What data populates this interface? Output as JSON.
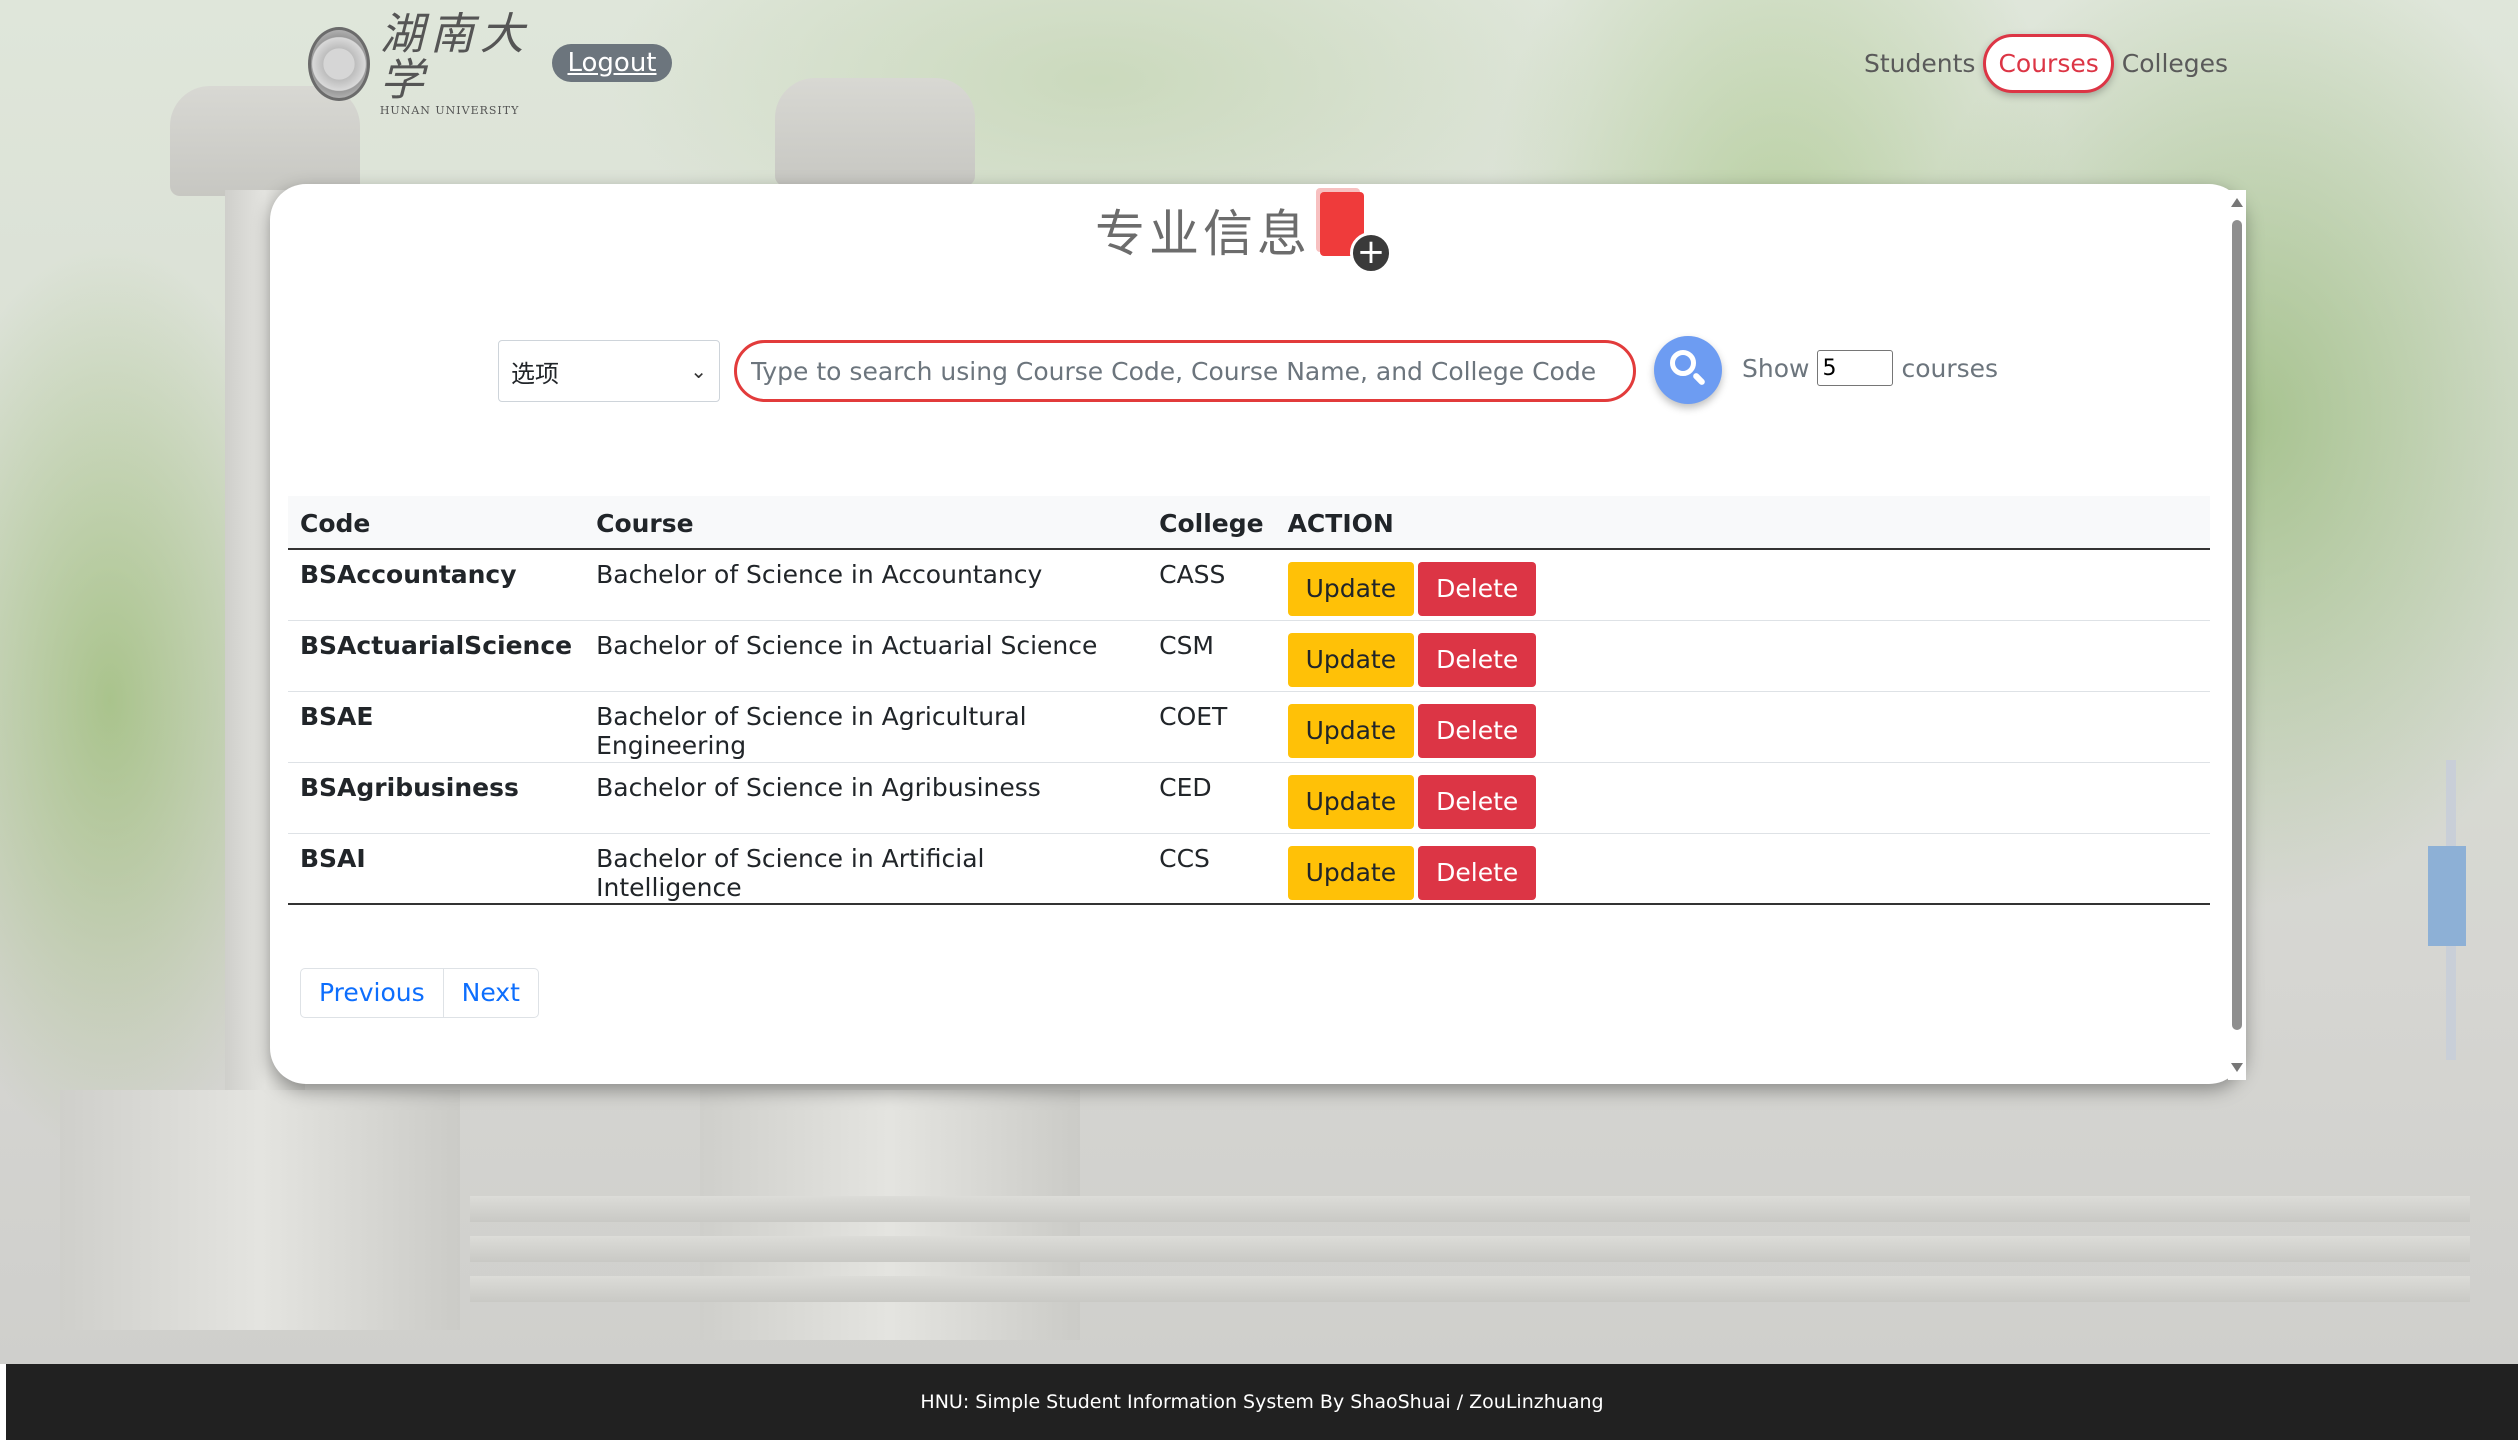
{
  "header": {
    "logo_cn": "湖南大学",
    "logo_en": "HUNAN UNIVERSITY",
    "logout_label": "Logout",
    "nav": [
      {
        "label": "Students",
        "active": false
      },
      {
        "label": "Courses",
        "active": true
      },
      {
        "label": "Colleges",
        "active": false
      }
    ]
  },
  "card": {
    "title": "专业信息",
    "add_icon": "add-document-icon"
  },
  "search": {
    "select_value": "选项",
    "placeholder": "Type to search using Course Code, Course Name, and College Code",
    "show_label": "Show",
    "show_value": "5",
    "show_suffix": "courses"
  },
  "table": {
    "headers": [
      "Code",
      "Course",
      "College",
      "ACTION"
    ],
    "rows": [
      {
        "code": "BSAccountancy",
        "course": "Bachelor of Science in Accountancy",
        "college": "CASS"
      },
      {
        "code": "BSActuarialScience",
        "course": "Bachelor of Science in Actuarial Science",
        "college": "CSM"
      },
      {
        "code": "BSAE",
        "course": "Bachelor of Science in Agricultural Engineering",
        "college": "COET"
      },
      {
        "code": "BSAgribusiness",
        "course": "Bachelor of Science in Agribusiness",
        "college": "CED"
      },
      {
        "code": "BSAI",
        "course": "Bachelor of Science in Artificial Intelligence",
        "college": "CCS"
      }
    ],
    "update_label": "Update",
    "delete_label": "Delete"
  },
  "pagination": {
    "previous_label": "Previous",
    "next_label": "Next"
  },
  "footer": {
    "text": "HNU: Simple Student Information System By ShaoShuai / ZouLinzhuang"
  },
  "colors": {
    "accent_red": "#dc3545",
    "update_yellow": "#ffc107",
    "search_blue": "#6d9cf2"
  }
}
